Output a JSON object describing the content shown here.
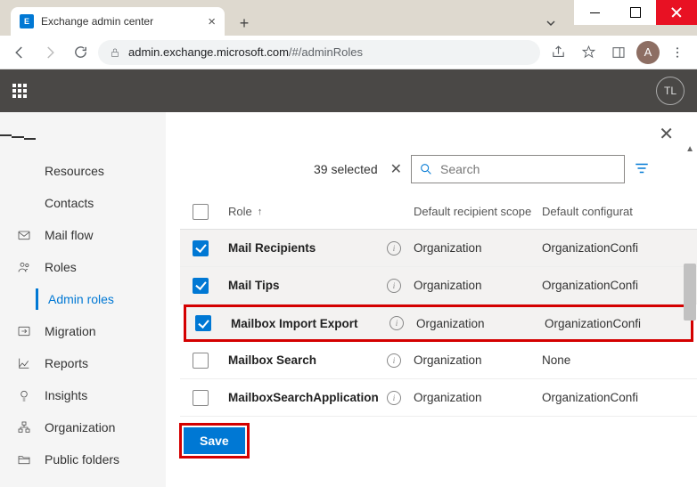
{
  "window": {
    "tab_title": "Exchange admin center"
  },
  "browser": {
    "url_host": "admin.exchange.microsoft.com",
    "url_path": "/#/adminRoles",
    "avatar_letter": "A"
  },
  "appbar": {
    "tenant_initials": "TL"
  },
  "sidebar": {
    "items": [
      {
        "icon": "",
        "label": "Resources"
      },
      {
        "icon": "",
        "label": "Contacts"
      },
      {
        "icon": "mail",
        "label": "Mail flow"
      },
      {
        "icon": "roles",
        "label": "Roles"
      },
      {
        "icon": "",
        "label": "Admin roles",
        "sub": true,
        "active": true
      },
      {
        "icon": "migration",
        "label": "Migration"
      },
      {
        "icon": "reports",
        "label": "Reports"
      },
      {
        "icon": "insights",
        "label": "Insights"
      },
      {
        "icon": "org",
        "label": "Organization"
      },
      {
        "icon": "folders",
        "label": "Public folders"
      }
    ]
  },
  "panel": {
    "selected_text": "39 selected",
    "search_placeholder": "Search",
    "columns": {
      "role": "Role",
      "scope": "Default recipient scope",
      "config": "Default configurat"
    },
    "rows": [
      {
        "checked": true,
        "name": "Mail Recipients",
        "scope": "Organization",
        "config": "OrganizationConfi"
      },
      {
        "checked": true,
        "name": "Mail Tips",
        "scope": "Organization",
        "config": "OrganizationConfi"
      },
      {
        "checked": true,
        "name": "Mailbox Import Export",
        "scope": "Organization",
        "config": "OrganizationConfi",
        "highlight": true
      },
      {
        "checked": false,
        "name": "Mailbox Search",
        "scope": "Organization",
        "config": "None"
      },
      {
        "checked": false,
        "name": "MailboxSearchApplication",
        "scope": "Organization",
        "config": "OrganizationConfi"
      }
    ],
    "save_label": "Save"
  }
}
